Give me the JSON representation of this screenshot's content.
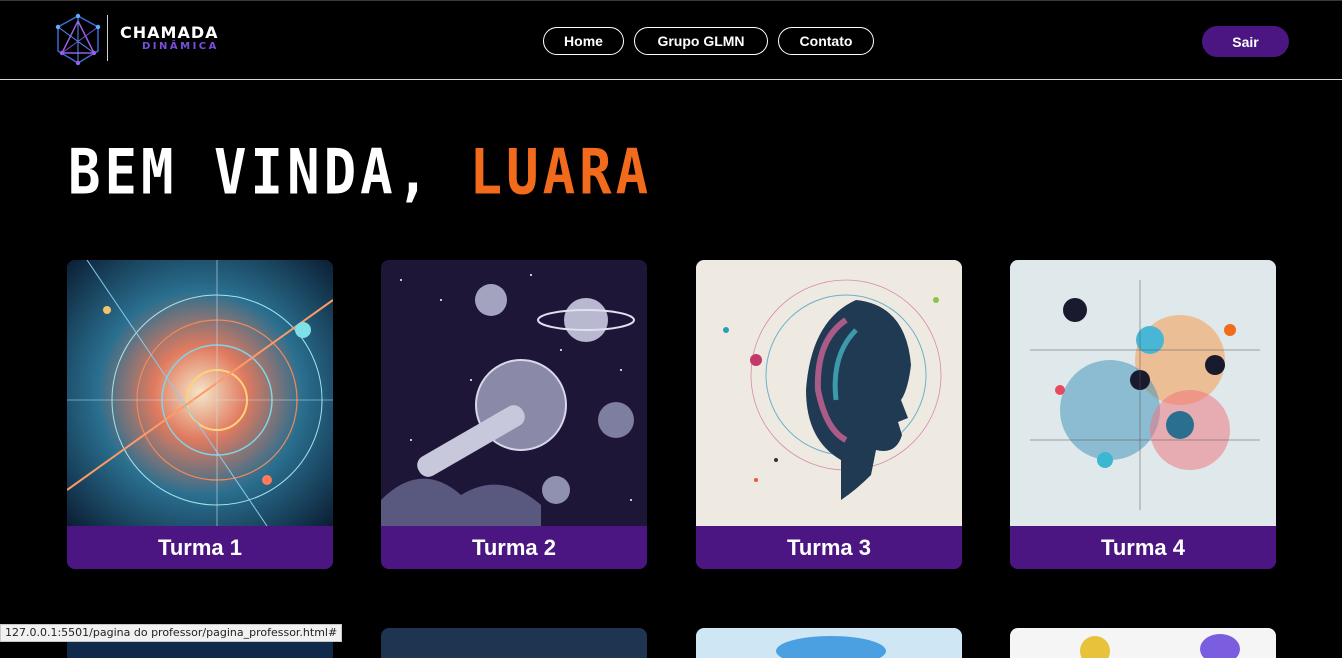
{
  "header": {
    "logo": {
      "title": "CHAMADA",
      "subtitle": "DINÂMICA"
    },
    "nav": [
      {
        "label": "Home"
      },
      {
        "label": "Grupo GLMN"
      },
      {
        "label": "Contato"
      }
    ],
    "logout_label": "Sair"
  },
  "greeting": {
    "prefix": "BEM VINDA, ",
    "name": "LUARA"
  },
  "classes": [
    {
      "label": "Turma 1",
      "image": "abstract-circles-art"
    },
    {
      "label": "Turma 2",
      "image": "space-planets-art"
    },
    {
      "label": "Turma 3",
      "image": "head-profile-art"
    },
    {
      "label": "Turma 4",
      "image": "abstract-orbs-art"
    }
  ],
  "status_bar": {
    "url": "127.0.0.1:5501/pagina do professor/pagina_professor.html#"
  },
  "colors": {
    "accent": "#4b1682",
    "name_highlight": "#f26b1d",
    "logo_sub": "#7a4fe0",
    "background": "#000000"
  }
}
